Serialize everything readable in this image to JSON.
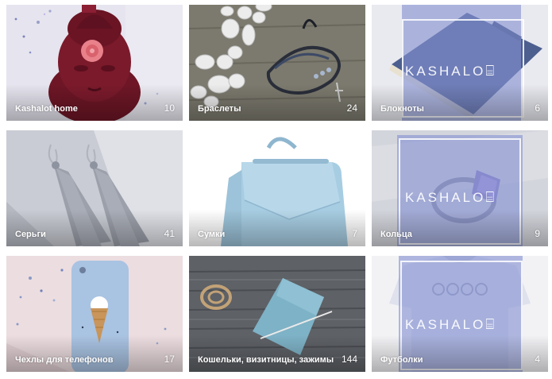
{
  "gallery": {
    "items": [
      {
        "title": "Kashalot home",
        "count": "10"
      },
      {
        "title": "Браслеты",
        "count": "24"
      },
      {
        "title": "Блокноты",
        "count": "6",
        "watermark": "KASHALO"
      },
      {
        "title": "Серьги",
        "count": "41"
      },
      {
        "title": "Сумки",
        "count": "7"
      },
      {
        "title": "Кольца",
        "count": "9",
        "watermark": "KASHALO"
      },
      {
        "title": "Чехлы для телефонов",
        "count": "17"
      },
      {
        "title": "Кошельки, визитницы, зажимы",
        "count": "144"
      },
      {
        "title": "Футболки",
        "count": "4",
        "watermark": "KASHALO"
      }
    ]
  },
  "watermark_glyph": "⌸",
  "colors": {
    "watermark_overlay": "#8492d2",
    "label_text": "#ffffff"
  }
}
